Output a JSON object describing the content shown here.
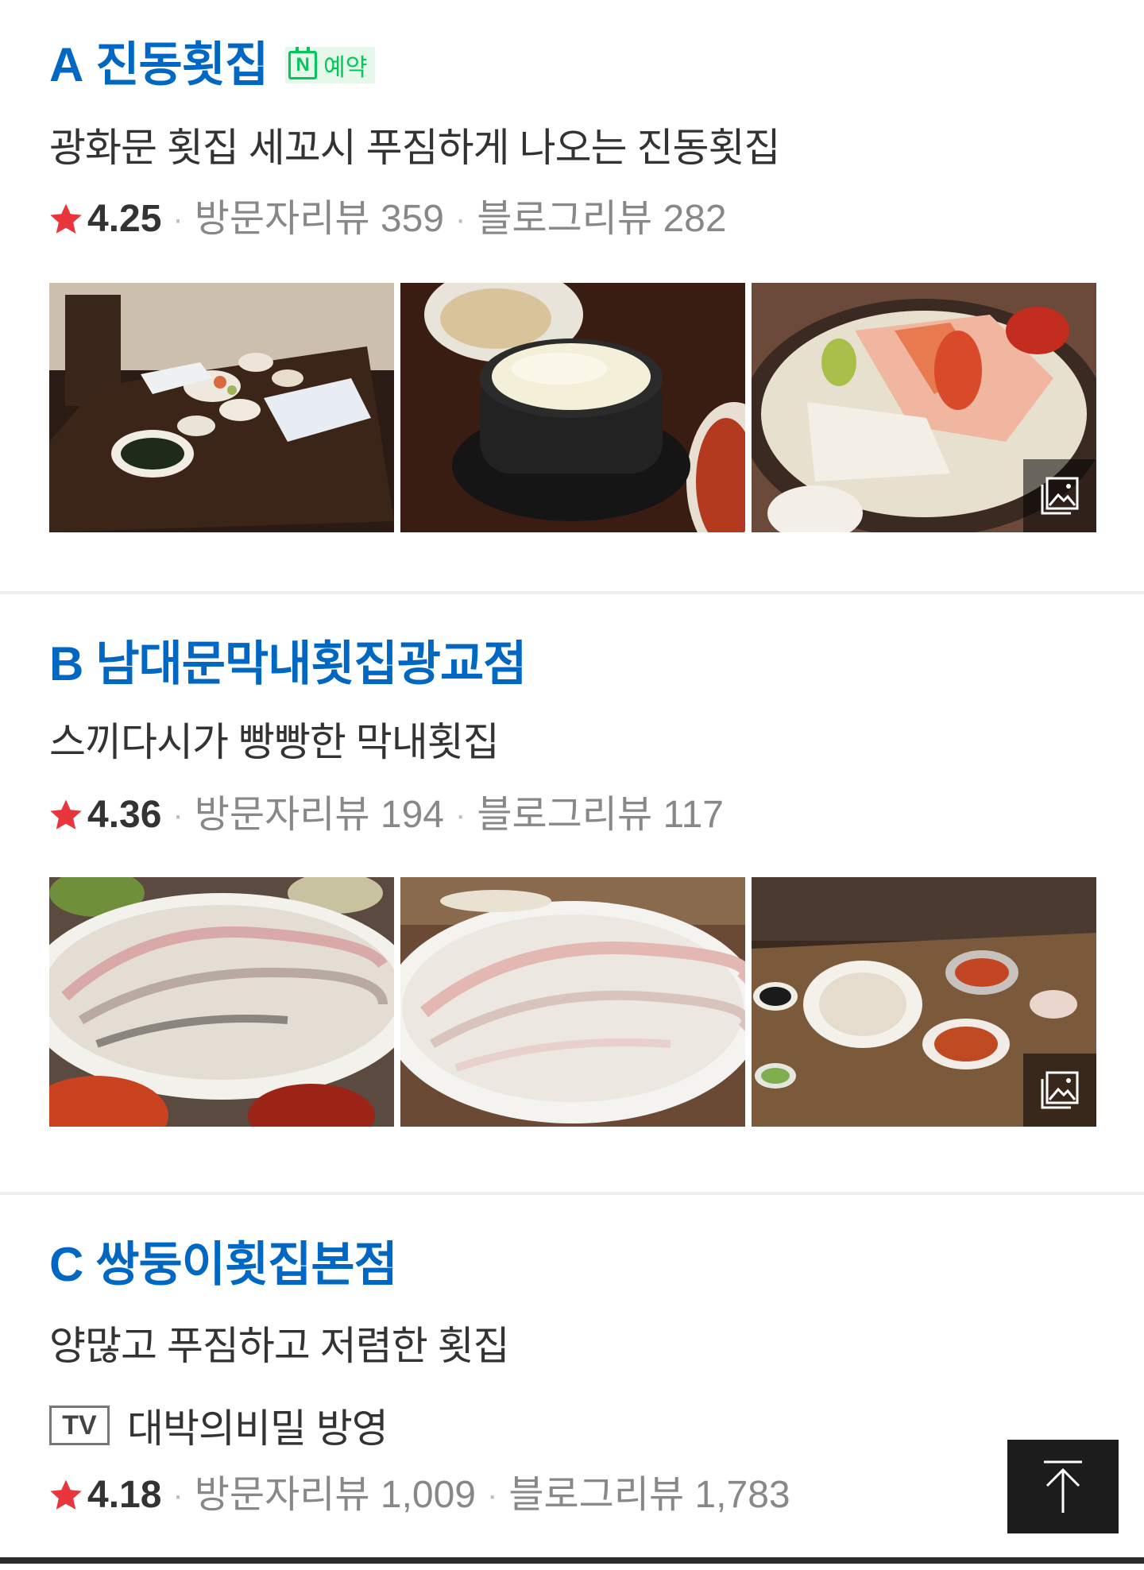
{
  "listings": [
    {
      "marker": "A",
      "name": "진동횟집",
      "booking_badge": {
        "icon": "naver-calendar-icon",
        "letter": "N",
        "label": "예약"
      },
      "description": "광화문 횟집 세꼬시 푸짐하게 나오는 진동횟집",
      "rating": "4.25",
      "visitor_reviews": "방문자리뷰 359",
      "blog_reviews": "블로그리뷰 282",
      "photos": [
        "restaurant-table-setting",
        "steamed-egg-stone-pot",
        "sashimi-platter-with-shrimp"
      ]
    },
    {
      "marker": "B",
      "name": "남대문막내횟집광교점",
      "description": "스끼다시가 빵빵한 막내횟집",
      "rating": "4.36",
      "visitor_reviews": "방문자리뷰 194",
      "blog_reviews": "블로그리뷰 117",
      "photos": [
        "sliced-raw-fish-platter",
        "raw-fish-plate-closeup",
        "full-table-spread"
      ]
    },
    {
      "marker": "C",
      "name": "쌍둥이횟집본점",
      "description": "양많고 푸짐하고 저렴한 횟집",
      "tv_badge": "TV",
      "tv_text": "대박의비밀 방영",
      "rating": "4.18",
      "visitor_reviews": "방문자리뷰 1,009",
      "blog_reviews": "블로그리뷰 1,783"
    }
  ],
  "colors": {
    "name": "#0068c3",
    "star": "#e8363c",
    "booking": "#03c75a",
    "muted": "#888888",
    "divider": "#ebeef0"
  },
  "icons": {
    "star": "star-icon",
    "more_photos": "image-gallery-icon",
    "scroll_top": "arrow-up-to-top-icon"
  },
  "separator": "·"
}
